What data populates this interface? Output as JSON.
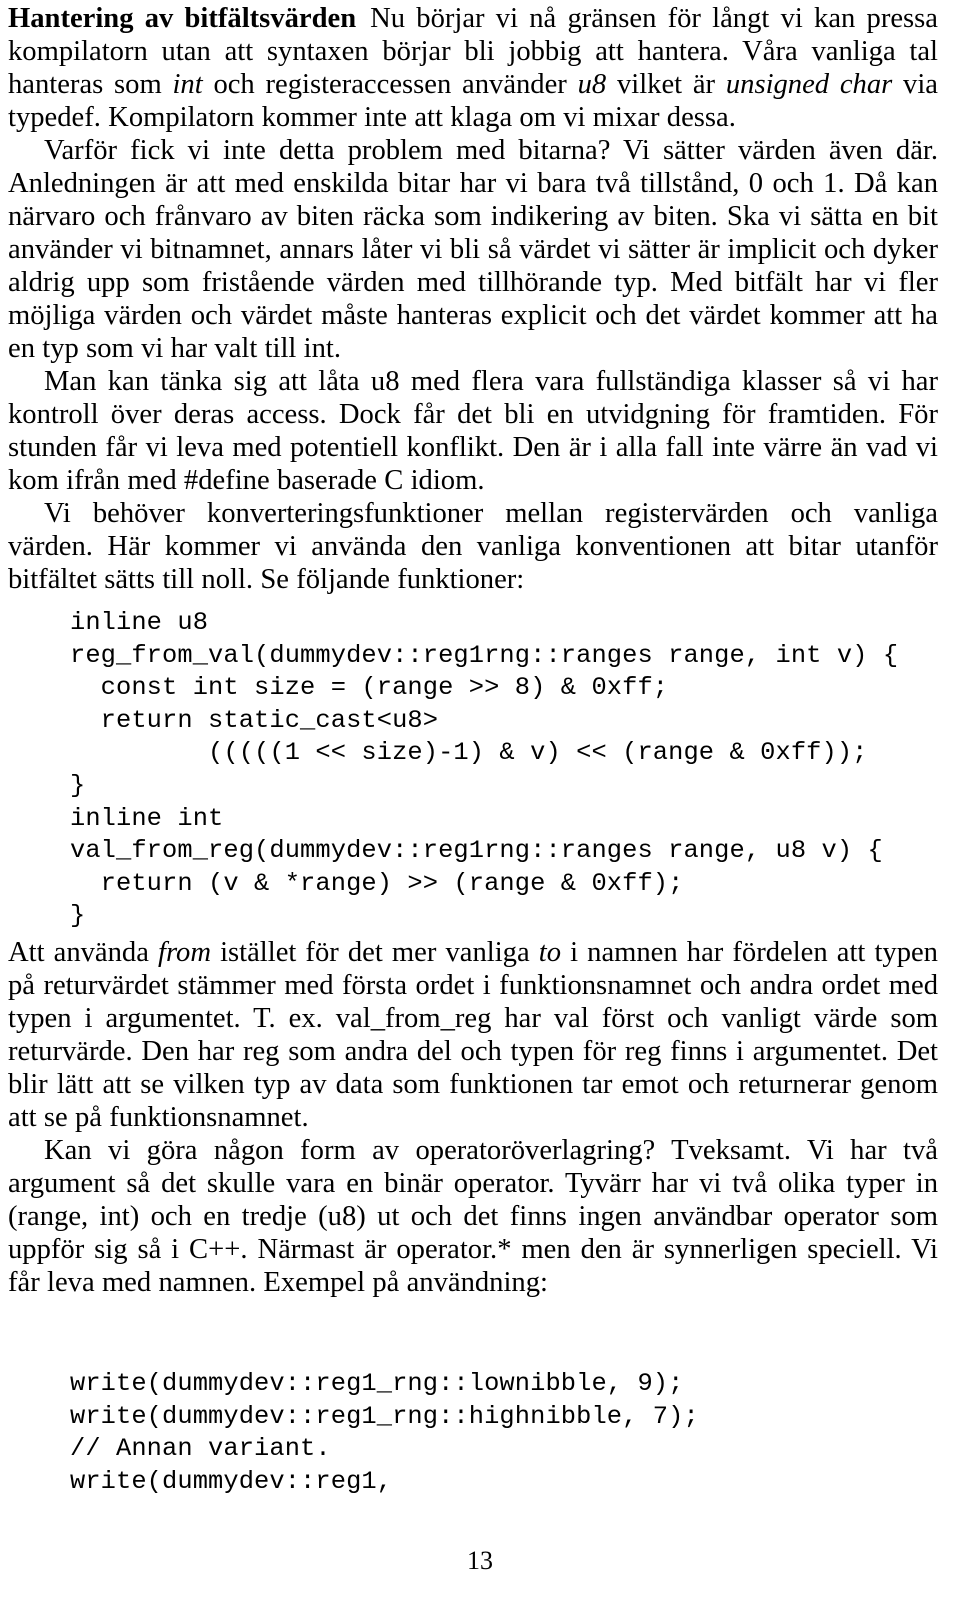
{
  "document": {
    "language": "sv",
    "page_number": "13"
  },
  "section": {
    "heading": "Hantering av bitfältsvärden"
  },
  "body": {
    "paragraph_1": {
      "run_1": "Nu börjar vi nå gränsen för långt vi kan pressa kompilatorn utan att syntaxen börjar bli jobbig att hantera. Våra vanliga tal hanteras som ",
      "italic_1": "int",
      "run_2": " och registeraccessen använder ",
      "italic_2": "u8",
      "run_3": " vilket är ",
      "italic_3": "unsigned char",
      "run_4": " via typedef. Kompilatorn kommer inte att klaga om vi mixar dessa."
    },
    "paragraph_2": "Varför fick vi inte detta problem med bitarna? Vi sätter värden även där. Anledningen är att med enskilda bitar har vi bara två tillstånd, 0 och 1. Då kan närvaro och frånvaro av biten räcka som indikering av biten. Ska vi sätta en bit använder vi bitnamnet, annars låter vi bli så värdet vi sätter är implicit och dyker aldrig upp som fristående värden med tillhörande typ. Med bitfält har vi fler möjliga värden och värdet måste hanteras explicit och det värdet kommer att ha en typ som vi har valt till int.",
    "paragraph_3": "Man kan tänka sig att låta u8 med flera vara fullständiga klasser så vi har kontroll över deras access. Dock får det bli en utvidgning för framtiden. För stunden får vi leva med potentiell konflikt. Den är i alla fall inte värre än vad vi kom ifrån med #define baserade C idiom.",
    "paragraph_4": "Vi behöver konverteringsfunktioner mellan registervärden och vanliga värden. Här kommer vi använda den vanliga konventionen att bitar utanför bitfältet sätts till noll. Se följande funktioner:",
    "paragraph_5": {
      "run_1": "Att använda ",
      "italic_1": "from",
      "run_2": " istället för det mer vanliga ",
      "italic_2": "to",
      "run_3": " i namnen har fördelen att typen på returvärdet stämmer med första ordet i funktionsnamnet och andra ordet med typen i argumentet. T. ex. val_from_reg har val först och vanligt värde som returvärde. Den har reg som andra del och typen för reg finns i argumentet. Det blir lätt att se vilken typ av data som funktionen tar emot och returnerar genom att se på funktionsnamnet."
    },
    "paragraph_6": "Kan vi göra någon form av operatoröverlagring? Tveksamt. Vi har två argument så det skulle vara en binär operator. Tyvärr har vi två olika typer in (range, int) och en tredje (u8) ut och det finns ingen användbar operator som uppför sig så i C++. Närmast är operator.* men den är synnerligen speciell. Vi får leva med namnen. Exempel på användning:"
  },
  "code_listing_1": {
    "lines": [
      "inline u8",
      "reg_from_val(dummydev::reg1rng::ranges range, int v) {",
      "  const int size = (range >> 8) & 0xff;",
      "  return static_cast<u8>",
      "         (((((1 << size)-1) & v) << (range & 0xff));",
      "}",
      "inline int",
      "val_from_reg(dummydev::reg1rng::ranges range, u8 v) {",
      "  return (v & *range) >> (range & 0xff);",
      "}"
    ],
    "text": "inline u8\nreg_from_val(dummydev::reg1rng::ranges range, int v) {\n  const int size = (range >> 8) & 0xff;\n  return static_cast<u8>\n         (((((1 << size)-1) & v) << (range & 0xff));\n}\ninline int\nval_from_reg(dummydev::reg1rng::ranges range, u8 v) {\n  return (v & *range) >> (range & 0xff);\n}"
  },
  "code_listing_2": {
    "lines": [
      "write(dummydev::reg1_rng::lownibble, 9);",
      "write(dummydev::reg1_rng::highnibble, 7);",
      "// Annan variant.",
      "write(dummydev::reg1,"
    ],
    "text": "write(dummydev::reg1_rng::lownibble, 9);\nwrite(dummydev::reg1_rng::highnibble, 7);\n// Annan variant.\nwrite(dummydev::reg1,"
  }
}
